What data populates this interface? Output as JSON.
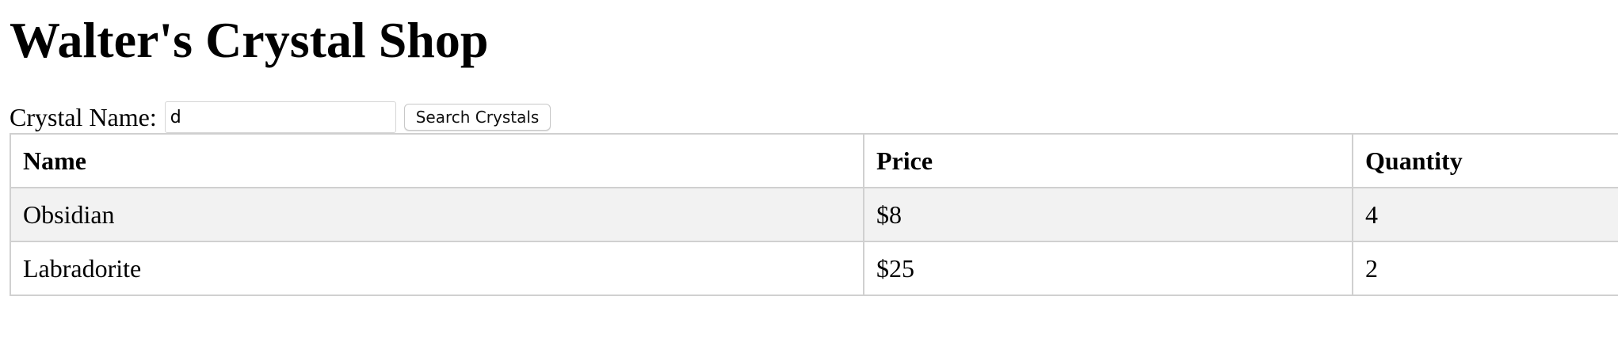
{
  "page": {
    "title": "Walter's Crystal Shop"
  },
  "search": {
    "label": "Crystal Name:",
    "value": "d",
    "placeholder": "",
    "button_label": "Search Crystals"
  },
  "table": {
    "headers": [
      "Name",
      "Price",
      "Quantity"
    ],
    "rows": [
      [
        "Obsidian",
        "$8",
        "4"
      ],
      [
        "Labradorite",
        "$25",
        "2"
      ]
    ],
    "stripe_color": "#f2f2f2",
    "border_color": "#d0d0d0"
  }
}
